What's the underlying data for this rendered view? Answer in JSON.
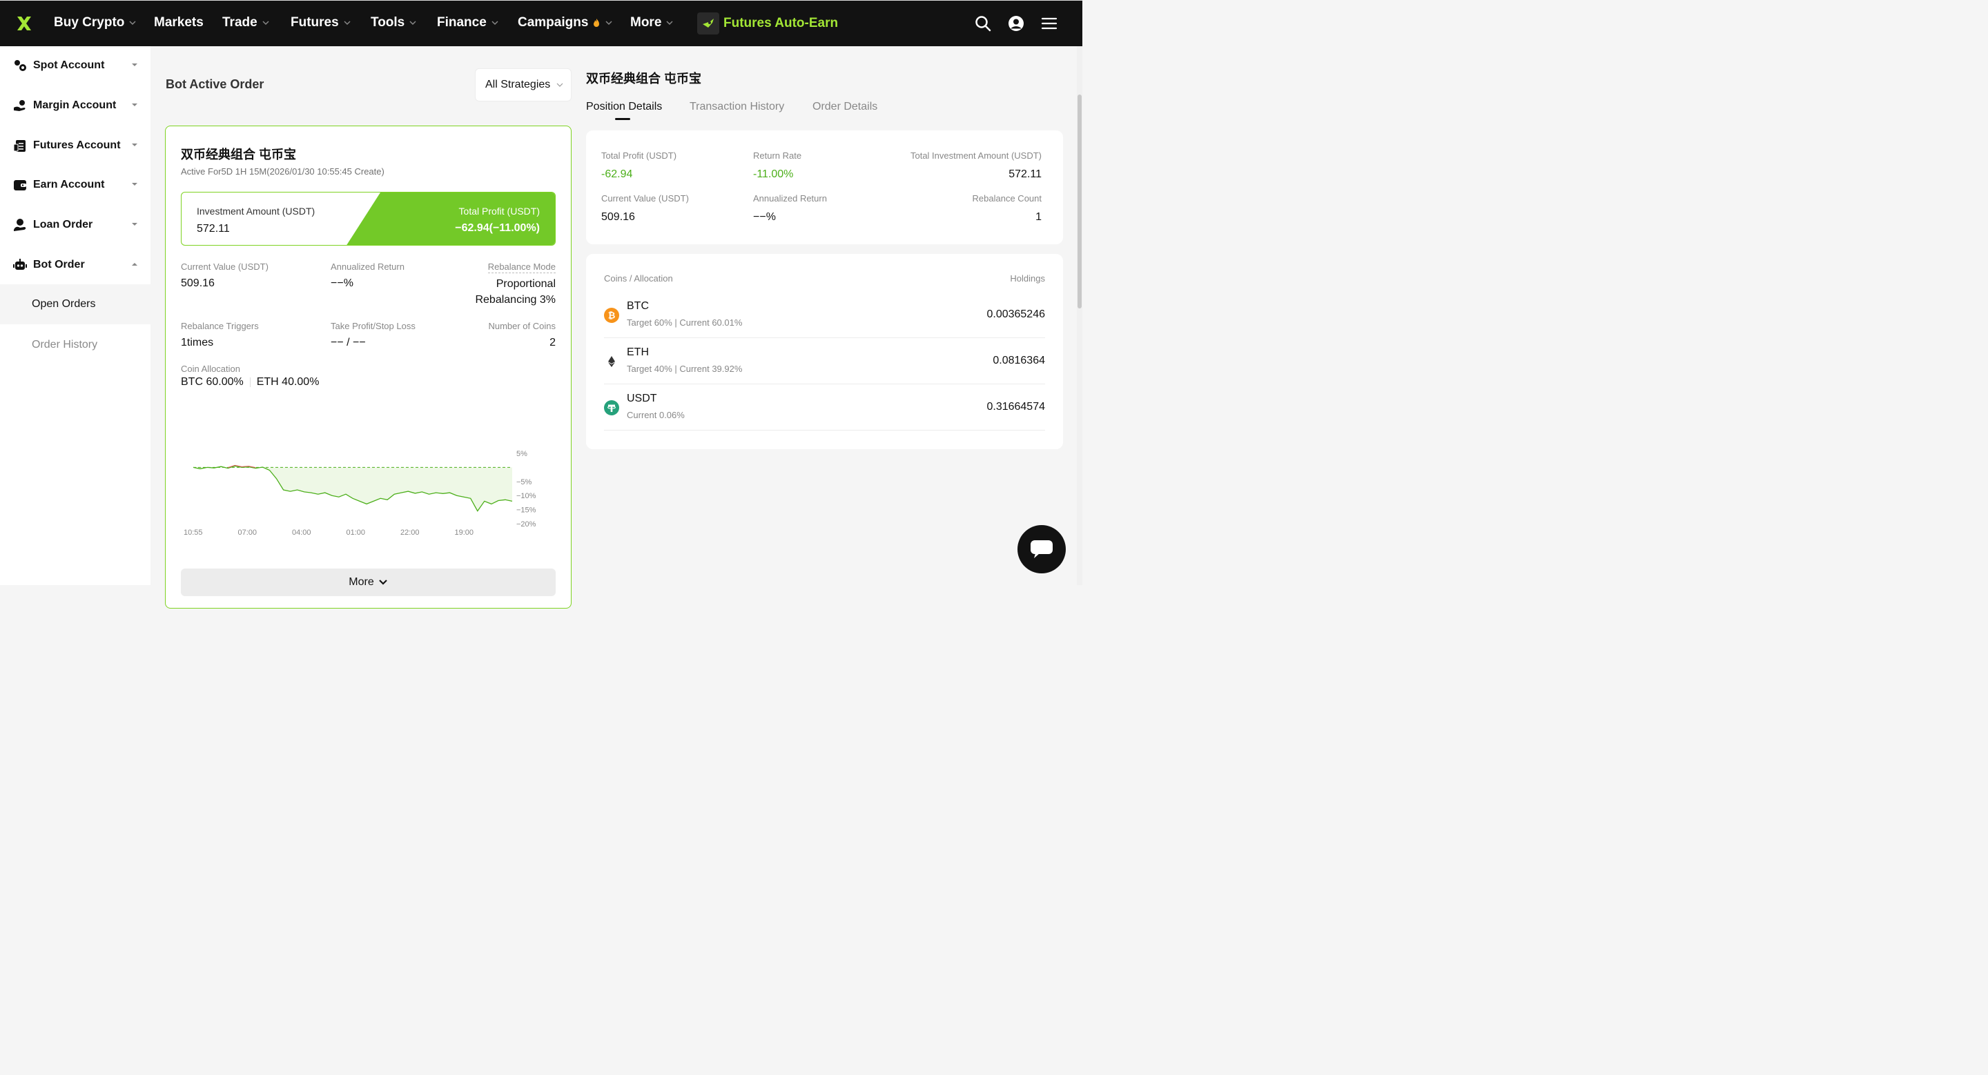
{
  "nav": {
    "items": [
      {
        "label": "Buy Crypto",
        "dropdown": true
      },
      {
        "label": "Markets",
        "dropdown": false
      },
      {
        "label": "Trade",
        "dropdown": true
      },
      {
        "label": "Futures",
        "dropdown": true
      },
      {
        "label": "Tools",
        "dropdown": true
      },
      {
        "label": "Finance",
        "dropdown": true
      },
      {
        "label": "Campaigns",
        "dropdown": true
      },
      {
        "label": "More",
        "dropdown": true
      }
    ],
    "promo": "Futures Auto-Earn",
    "icons": [
      "search-icon",
      "user-icon",
      "menu-icon"
    ],
    "brand_color": "#a3e635"
  },
  "sidebar": {
    "items": [
      {
        "label": "Spot Account",
        "icon": "spot-icon",
        "expanded": false
      },
      {
        "label": "Margin Account",
        "icon": "margin-icon",
        "expanded": false
      },
      {
        "label": "Futures Account",
        "icon": "futures-icon",
        "expanded": false
      },
      {
        "label": "Earn Account",
        "icon": "earn-icon",
        "expanded": false
      },
      {
        "label": "Loan Order",
        "icon": "loan-icon",
        "expanded": false
      },
      {
        "label": "Bot Order",
        "icon": "bot-icon",
        "expanded": true
      }
    ],
    "sub_items": [
      {
        "label": "Open Orders",
        "active": true
      },
      {
        "label": "Order History",
        "active": false
      }
    ]
  },
  "main": {
    "title": "Bot Active Order",
    "strategy_filter": "All Strategies",
    "card": {
      "title": "双币经典组合 屯币宝",
      "subtitle": "Active For5D 1H 15M(2026/01/30 10:55:45 Create)",
      "investment_label": "Investment Amount (USDT)",
      "investment_value": "572.11",
      "profit_label": "Total Profit (USDT)",
      "profit_value": "−62.94(−11.00%)",
      "stats": {
        "current_value_label": "Current Value (USDT)",
        "current_value": "509.16",
        "annualized_label": "Annualized Return",
        "annualized_value": "−−%",
        "rebalance_mode_label": "Rebalance Mode",
        "rebalance_mode_line1": "Proportional",
        "rebalance_mode_line2": "Rebalancing 3%",
        "triggers_label": "Rebalance Triggers",
        "triggers_value": "1times",
        "tpsl_label": "Take Profit/Stop Loss",
        "tpsl_value": "−− / −−",
        "coins_label": "Number of Coins",
        "coins_value": "2",
        "allocation_label": "Coin Allocation",
        "allocation_btc": "BTC 60.00%",
        "allocation_eth": "ETH 40.00%"
      },
      "more_label": "More"
    }
  },
  "chart_data": {
    "type": "line",
    "x_ticks": [
      "10:55",
      "07:00",
      "04:00",
      "01:00",
      "22:00",
      "19:00"
    ],
    "y_ticks": [
      "5%",
      "−5%",
      "−10%",
      "−15%",
      "−20%"
    ],
    "ylim": [
      -20,
      5
    ],
    "baseline": 0,
    "series": [
      {
        "values": [
          0,
          -0.5,
          0,
          -0.2,
          0.3,
          -0.3,
          0.5,
          0,
          0.2,
          -0.3,
          0.1,
          -1,
          -4,
          -8,
          -8.5,
          -8,
          -8.7,
          -9,
          -9.5,
          -9,
          -10,
          -10.5,
          -9.5,
          -11,
          -12,
          -13,
          -12,
          -11,
          -11.5,
          -9.5,
          -9,
          -8.5,
          -9.2,
          -8.7,
          -9.5,
          -9,
          -9.3,
          -9,
          -10,
          -10.5,
          -11,
          -15.5,
          -12,
          -13,
          -11.8,
          -11.5,
          -12
        ]
      }
    ],
    "colors": {
      "line": "#4caf1a",
      "fill": "#eef8e6",
      "baseline": "#4caf1a",
      "early_line": "#e05a5a"
    }
  },
  "right_panel": {
    "title": "双币经典组合 屯币宝",
    "tabs": [
      "Position Details",
      "Transaction History",
      "Order Details"
    ],
    "summary": {
      "total_profit_label": "Total Profit (USDT)",
      "total_profit": "-62.94",
      "return_rate_label": "Return Rate",
      "return_rate": "-11.00%",
      "total_investment_label": "Total Investment Amount (USDT)",
      "total_investment": "572.11",
      "current_value_label": "Current Value (USDT)",
      "current_value": "509.16",
      "annualized_label": "Annualized Return",
      "annualized_value": "−−%",
      "rebalance_count_label": "Rebalance Count",
      "rebalance_count": "1"
    },
    "allocation": {
      "header_left": "Coins / Allocation",
      "header_right": "Holdings",
      "coins": [
        {
          "name": "BTC",
          "desc": "Target 60% | Current 60.01%",
          "holding": "0.00365246",
          "icon": "btc-icon",
          "color": "#f7931a"
        },
        {
          "name": "ETH",
          "desc": "Target 40% | Current 39.92%",
          "holding": "0.0816364",
          "icon": "eth-icon",
          "color": "#333333"
        },
        {
          "name": "USDT",
          "desc": "Current 0.06%",
          "holding": "0.31664574",
          "icon": "usdt-icon",
          "color": "#26a17b"
        }
      ]
    }
  }
}
